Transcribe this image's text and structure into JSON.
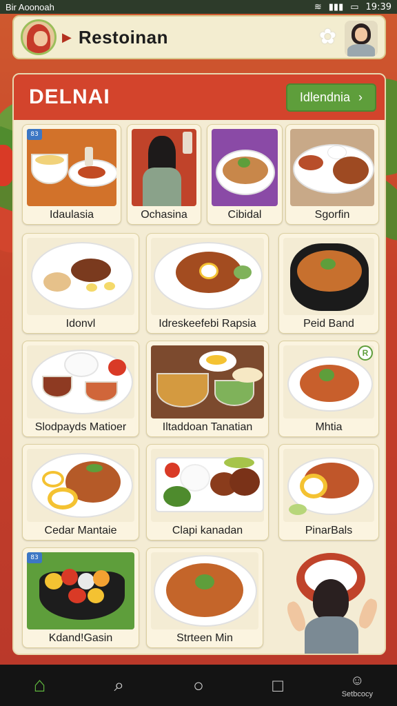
{
  "status_bar": {
    "left": "Bir Aoonoah",
    "time": "19:39"
  },
  "header": {
    "title": "Restoinan"
  },
  "panel": {
    "title": "DELNAI",
    "action_label": "Idlendnia"
  },
  "cards": [
    {
      "label": "Idaulasia",
      "tag": "83"
    },
    {
      "label": "Ochasina"
    },
    {
      "label": "Cibidal"
    },
    {
      "label": "Sgorfin"
    },
    {
      "label": "Idonvl"
    },
    {
      "label": "Idreskeefebi Rapsia"
    },
    {
      "label": "Peid Band"
    },
    {
      "label": "Slodpayds Matioer"
    },
    {
      "label": "Iltaddoan Tanatian"
    },
    {
      "label": "Mhtia",
      "badge": "R"
    },
    {
      "label": "Cedar Mantaie"
    },
    {
      "label": "Clapi kanadan"
    },
    {
      "label": "PinarBals"
    },
    {
      "label": "Kdand!Gasin",
      "tag": "83"
    },
    {
      "label": "Strteen Min"
    }
  ],
  "nav": {
    "account_label": "Setbcocy"
  },
  "colors": {
    "accent_red": "#d3442c",
    "accent_green": "#5e9e3b",
    "panel_bg": "#f4ecd4"
  }
}
